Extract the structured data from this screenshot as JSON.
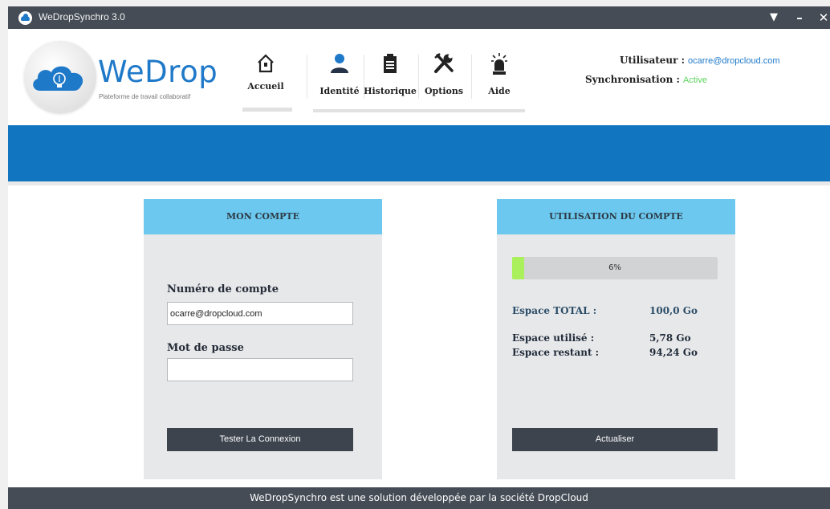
{
  "titlebar": {
    "title": "WeDropSynchro 3.0",
    "menu_icon": "menu-down-icon",
    "min_icon": "minimize-icon",
    "close_icon": "close-icon"
  },
  "logo": {
    "name": "WeDrop",
    "tagline": "Plateforme de travail collaboratif"
  },
  "nav": {
    "items": [
      {
        "label": "Accueil",
        "icon": "home-icon"
      },
      {
        "label": "Identité",
        "icon": "user-icon"
      },
      {
        "label": "Historique",
        "icon": "clipboard-icon"
      },
      {
        "label": "Options",
        "icon": "tools-icon"
      },
      {
        "label": "Aide",
        "icon": "alarm-light-icon"
      }
    ]
  },
  "user": {
    "user_label": "Utilisateur :",
    "user_value": "ocarre@dropcloud.com",
    "sync_label": "Synchronisation :",
    "sync_value": "Active"
  },
  "account": {
    "header": "MON COMPTE",
    "account_number_label": "Numéro de compte",
    "account_number_value": "ocarre@dropcloud.com",
    "password_label": "Mot de passe",
    "password_value": "",
    "test_button": "Tester La Connexion"
  },
  "usage": {
    "header": "UTILISATION DU COMPTE",
    "progress_percent": 6,
    "progress_text": "6%",
    "total_label": "Espace TOTAL :",
    "total_value": "100,0 Go",
    "used_label": "Espace utilisé :",
    "used_value": "5,78 Go",
    "remaining_label": "Espace restant :",
    "remaining_value": "94,24 Go",
    "refresh_button": "Actualiser"
  },
  "footer": {
    "text": "WeDropSynchro est une solution développée par la société DropCloud"
  },
  "colors": {
    "accent_blue": "#1175c0",
    "panel_header": "#6cc8ee",
    "dark_button": "#3d444e",
    "progress_fill": "#a9f05c",
    "sync_active": "#5bd35b"
  }
}
